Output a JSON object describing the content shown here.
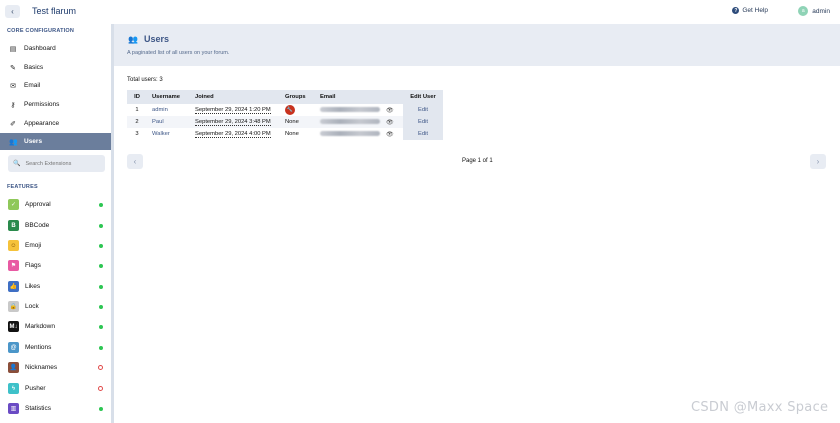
{
  "header": {
    "back_icon": "chevron-left-icon",
    "forum_title": "Test flarum",
    "help_label": "Get Help",
    "user_avatar_letter": "a",
    "user_name": "admin"
  },
  "sidebar": {
    "core_heading": "CORE CONFIGURATION",
    "core_items": [
      {
        "label": "Dashboard",
        "icon": "chart-icon"
      },
      {
        "label": "Basics",
        "icon": "pencil-icon"
      },
      {
        "label": "Email",
        "icon": "envelope-icon"
      },
      {
        "label": "Permissions",
        "icon": "key-icon"
      },
      {
        "label": "Appearance",
        "icon": "paintbrush-icon"
      },
      {
        "label": "Users",
        "icon": "users-icon",
        "active": true
      }
    ],
    "search_placeholder": "Search Extensions",
    "features_heading": "FEATURES",
    "extensions": [
      {
        "label": "Approval",
        "icon": "check-icon",
        "color": "#8fc85a",
        "enabled": true
      },
      {
        "label": "BBCode",
        "icon": "b-icon",
        "color": "#2a8a4c",
        "enabled": true
      },
      {
        "label": "Emoji",
        "icon": "smile-icon",
        "color": "#f5c23a",
        "enabled": true
      },
      {
        "label": "Flags",
        "icon": "flag-icon",
        "color": "#e85aa3",
        "enabled": true
      },
      {
        "label": "Likes",
        "icon": "thumbs-up-icon",
        "color": "#3f6fc4",
        "enabled": true
      },
      {
        "label": "Lock",
        "icon": "lock-icon",
        "color": "#c9c9c9",
        "enabled": true
      },
      {
        "label": "Markdown",
        "icon": "markdown-icon",
        "color": "#111111",
        "enabled": true
      },
      {
        "label": "Mentions",
        "icon": "at-icon",
        "color": "#4b96c9",
        "enabled": true
      },
      {
        "label": "Nicknames",
        "icon": "user-tag-icon",
        "color": "#8a4e3a",
        "enabled": false
      },
      {
        "label": "Pusher",
        "icon": "bolt-icon",
        "color": "#3ec1c9",
        "enabled": false
      },
      {
        "label": "Statistics",
        "icon": "bar-chart-icon",
        "color": "#6a4bc4",
        "enabled": true
      }
    ]
  },
  "main": {
    "title": "Users",
    "description": "A paginated list of all users on your forum.",
    "total_users": "Total users: 3",
    "columns": [
      "ID",
      "Username",
      "Joined",
      "Groups",
      "Email",
      "Edit User"
    ],
    "rows": [
      {
        "id": "1",
        "username": "admin",
        "joined": "September 29, 2024 1:20 PM",
        "group": "admin-badge",
        "edit": "Edit"
      },
      {
        "id": "2",
        "username": "Paul",
        "joined": "September 29, 2024 3:48 PM",
        "group": "None",
        "edit": "Edit"
      },
      {
        "id": "3",
        "username": "Walker",
        "joined": "September 29, 2024 4:00 PM",
        "group": "None",
        "edit": "Edit"
      }
    ],
    "pagination": "Page 1 of 1"
  },
  "watermark": "CSDN @Maxx Space"
}
